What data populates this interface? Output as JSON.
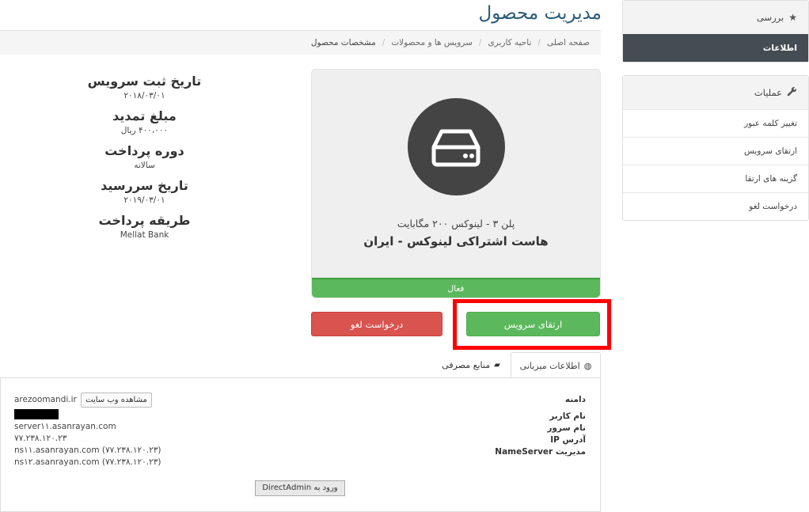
{
  "page_title": "مدیریت محصول",
  "breadcrumb": {
    "items": [
      "صفحه اصلی",
      "ناحیه کاربری",
      "سرویس ها و محصولات"
    ],
    "active": "مشخصات محصول"
  },
  "sidebar": {
    "overview": {
      "title": "بررسی",
      "icon": "star-icon",
      "items": [
        "اطلاعات"
      ]
    },
    "actions": {
      "title": "عملیات",
      "icon": "wrench-icon",
      "items": [
        "تغییر کلمه عبور",
        "ارتقای سرویس",
        "گزینه های ارتقا",
        "درخواست لغو"
      ]
    }
  },
  "service_info": {
    "reg_date_label": "تاریخ ثبت سرویس",
    "reg_date": "۲۰۱۸/۰۳/۰۱",
    "renew_amount_label": "مبلغ تمدید",
    "renew_amount": "۴۰۰،۰۰۰ ریال",
    "billing_cycle_label": "دوره پرداخت",
    "billing_cycle": "سالانه",
    "due_date_label": "تاریخ سررسید",
    "due_date": "۲۰۱۹/۰۳/۰۱",
    "payment_method_label": "طریقه پرداخت",
    "payment_method": "Mellat Bank"
  },
  "product": {
    "plan": "پلن ۳ - لینوکس ۲۰۰ مگابایت",
    "name": "هاست اشتراکی لینوکس - ایران",
    "status": "فعال",
    "icon": "server-drive-icon",
    "status_color": "#5cb85c"
  },
  "buttons": {
    "upgrade": "ارتقای سرویس",
    "cancel": "درخواست لغو"
  },
  "tabs": {
    "hosting_info": "اطلاعات میزبانی",
    "resources": "منابع مصرفی"
  },
  "hosting": {
    "labels": [
      "دامنه",
      "نام کاربر",
      "نام سرور",
      "آدرس IP",
      "مدیریت NameServer"
    ],
    "domain": "arezoomandi.ir",
    "view_site": "مشاهده وب سایت",
    "server": "server۱۱.asanrayan.com",
    "ip": "۷۷.۲۳۸.۱۲۰.۲۳",
    "ns1": "ns۱۱.asanrayan.com (۷۷.۲۳۸.۱۲۰.۲۳)",
    "ns2": "ns۱۲.asanrayan.com (۷۷.۲۳۸.۱۲۰.۲۳)",
    "login_button": "ورود به DirectAdmin"
  },
  "colors": {
    "accent_title": "#2b5c7a",
    "danger": "#d9534f",
    "success": "#5cb85c",
    "highlight": "#ff0000"
  }
}
